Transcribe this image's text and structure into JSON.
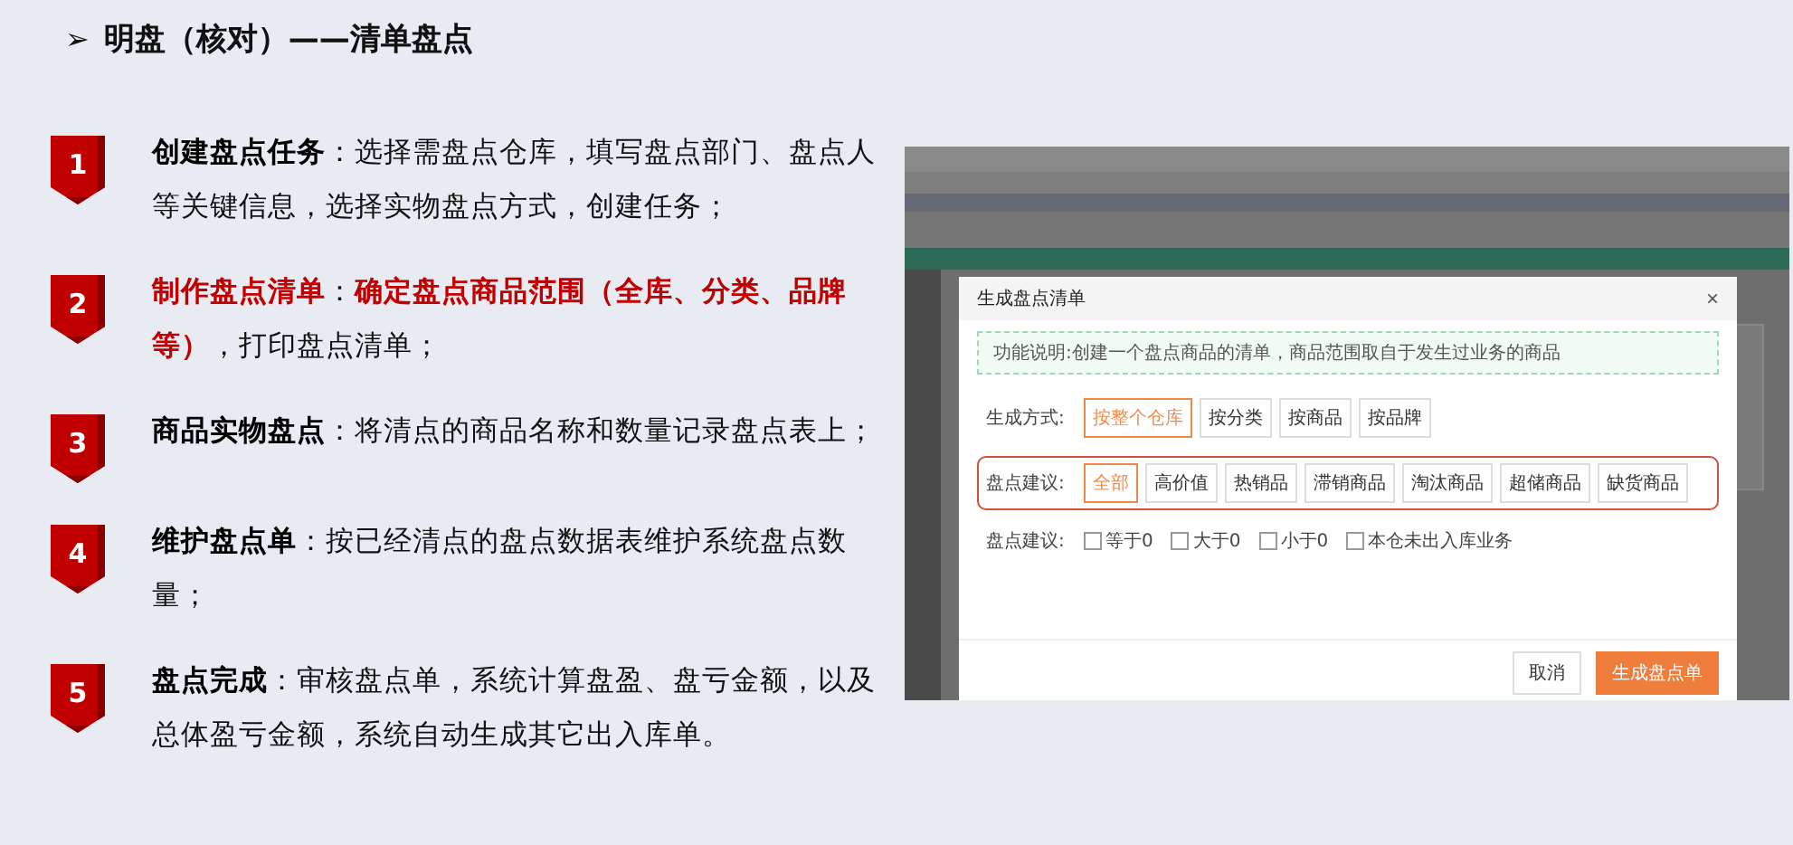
{
  "title": {
    "marker": "➢",
    "text": "明盘（核对）——清单盘点"
  },
  "steps": [
    {
      "number": "1",
      "text": "**创建盘点任务**：选择需盘点仓库，填写盘点部门、盘点人等关键信息，选择实物盘点方式，创建任务；",
      "highlight": false
    },
    {
      "number": "2",
      "text": "**制作盘点清单**：**确定盘点商品范围（全库、分类、品牌等）**，打印盘点清单；",
      "highlight": true
    },
    {
      "number": "3",
      "text": "**商品实物盘点**：将清点的商品名称和数量记录盘点表上；",
      "highlight": false
    },
    {
      "number": "4",
      "text": "**维护盘点单**：按已经清点的盘点数据表维护系统盘点数量；",
      "highlight": false
    },
    {
      "number": "5",
      "text": "**盘点完成**：审核盘点单，系统计算盘盈、盘亏金额，以及总体盈亏金额，系统自动生成其它出入库单。",
      "highlight": false
    }
  ],
  "screenshot": {
    "dialog": {
      "title": "生成盘点清单",
      "close": "×",
      "notice": "功能说明:创建一个盘点商品的清单，商品范围取自于发生过业务的商品",
      "mode": {
        "label": "生成方式:",
        "options": [
          {
            "label": "按整个仓库",
            "selected": true
          },
          {
            "label": "按分类",
            "selected": false
          },
          {
            "label": "按商品",
            "selected": false
          },
          {
            "label": "按品牌",
            "selected": false
          }
        ]
      },
      "suggestion": {
        "label": "盘点建议:",
        "options": [
          {
            "label": "全部",
            "selected": true
          },
          {
            "label": "高价值",
            "selected": false
          },
          {
            "label": "热销品",
            "selected": false
          },
          {
            "label": "滞销商品",
            "selected": false
          },
          {
            "label": "淘汰商品",
            "selected": false
          },
          {
            "label": "超储商品",
            "selected": false
          },
          {
            "label": "缺货商品",
            "selected": false
          }
        ]
      },
      "filters": {
        "label": "盘点建议:",
        "options": [
          {
            "label": "等于0",
            "checked": false
          },
          {
            "label": "大于0",
            "checked": false
          },
          {
            "label": "小于0",
            "checked": false
          },
          {
            "label": "本仓未出入库业务",
            "checked": false
          }
        ]
      },
      "buttons": [
        {
          "label": "取消",
          "kind": "secondary"
        },
        {
          "label": "生成盘点单",
          "kind": "primary"
        }
      ]
    }
  }
}
